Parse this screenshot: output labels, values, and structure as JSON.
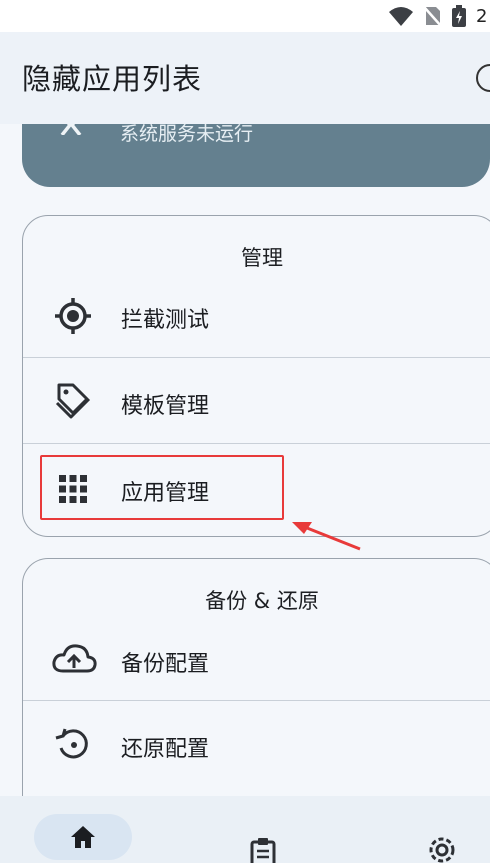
{
  "status_bar": {
    "time_fragment": "2",
    "icons": [
      "wifi-icon",
      "no-sim-icon",
      "battery-charging-icon"
    ]
  },
  "app_bar": {
    "title": "隐藏应用列表"
  },
  "status_card": {
    "text": "系统服务未运行",
    "icon": "service-status-icon"
  },
  "management": {
    "title": "管理",
    "items": [
      {
        "label": "拦截测试",
        "icon": "crosshair-icon"
      },
      {
        "label": "模板管理",
        "icon": "tag-icon"
      },
      {
        "label": "应用管理",
        "icon": "apps-grid-icon"
      }
    ]
  },
  "backup": {
    "title": "备份 & 还原",
    "items": [
      {
        "label": "备份配置",
        "icon": "cloud-upload-icon"
      },
      {
        "label": "还原配置",
        "icon": "restore-icon"
      }
    ]
  },
  "bottom_nav": {
    "items": [
      {
        "icon": "home-icon",
        "selected": true
      },
      {
        "icon": "logs-icon",
        "selected": false
      },
      {
        "icon": "settings-icon",
        "selected": false
      }
    ]
  },
  "colors": {
    "annotation": "#e83a3a",
    "status_card": "#64808f",
    "background": "#f4f7fb"
  }
}
